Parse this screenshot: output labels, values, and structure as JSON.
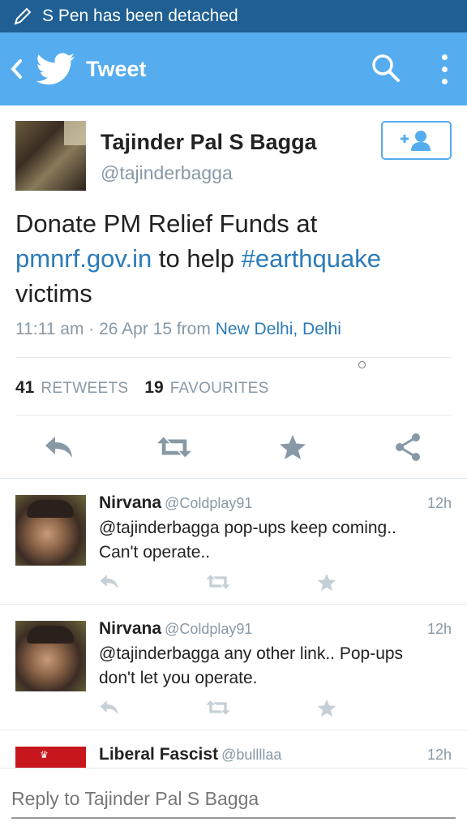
{
  "status_bar": {
    "text": "S Pen has been detached"
  },
  "app_bar": {
    "title": "Tweet"
  },
  "tweet": {
    "author_name": "Tajinder Pal S Bagga",
    "author_handle": "@tajinderbagga",
    "text_part1": "Donate PM Relief Funds at ",
    "link": "pmnrf.gov.in",
    "text_part2": " to help ",
    "hashtag": "#earthquake",
    "text_part3": " victims",
    "time": "11:11 am · 26 Apr 15",
    "from": " from ",
    "place": "New Delhi, Delhi",
    "retweet_count": "41",
    "retweet_label": "RETWEETS",
    "favourite_count": "19",
    "favourite_label": "FAVOURITES"
  },
  "replies": [
    {
      "name": "Nirvana",
      "handle": "@Coldplay91",
      "time": "12h",
      "text": "@tajinderbagga pop-ups keep coming.. Can't operate.."
    },
    {
      "name": "Nirvana",
      "handle": "@Coldplay91",
      "time": "12h",
      "text": "@tajinderbagga any other link.. Pop-ups don't let you operate."
    },
    {
      "name": "Liberal Fascist",
      "handle": "@bullllaa",
      "time": "12h"
    }
  ],
  "composer": {
    "placeholder": "Reply to Tajinder Pal S Bagga"
  },
  "colors": {
    "accent": "#55acee",
    "status_bar": "#1f5f93",
    "link": "#2b7bb9",
    "muted": "#8899a6"
  }
}
